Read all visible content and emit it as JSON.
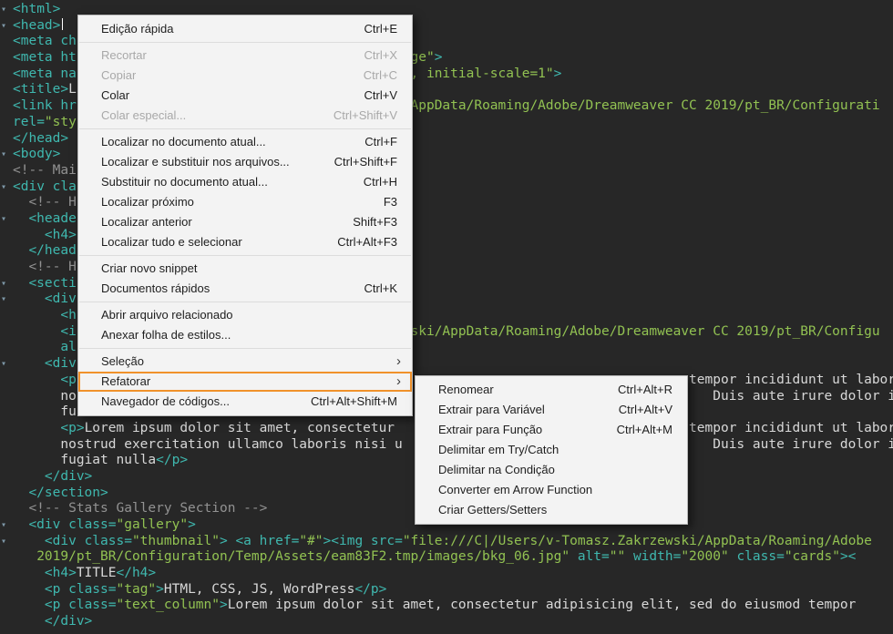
{
  "editor": {
    "background": "#272727",
    "token_colors": {
      "tag": "#3FB8AF",
      "str": "#92C252",
      "text": "#D8D8D8",
      "comment": "#929292"
    },
    "fold_icon": "▾",
    "lines": [
      {
        "fold": true,
        "runs": [
          {
            "col": 0,
            "parts": [
              {
                "t": "<html>",
                "c": "tag"
              }
            ]
          }
        ]
      },
      {
        "fold": true,
        "runs": [
          {
            "col": 0,
            "parts": [
              {
                "t": "<head>",
                "c": "tag"
              },
              {
                "t": "",
                "c": "caret"
              }
            ]
          }
        ]
      },
      {
        "runs": [
          {
            "col": 0,
            "parts": [
              {
                "t": "<meta ch",
                "c": "tag"
              }
            ]
          }
        ]
      },
      {
        "runs": [
          {
            "col": 0,
            "parts": [
              {
                "t": "<meta ht",
                "c": "tag"
              }
            ]
          },
          {
            "col": 50,
            "parts": [
              {
                "t": "ge\"",
                "c": "str"
              },
              {
                "t": ">",
                "c": "tag"
              }
            ]
          }
        ]
      },
      {
        "runs": [
          {
            "col": 0,
            "parts": [
              {
                "t": "<meta na",
                "c": "tag"
              }
            ]
          },
          {
            "col": 50,
            "parts": [
              {
                "t": ", initial-scale=1\"",
                "c": "str"
              },
              {
                "t": ">",
                "c": "tag"
              }
            ]
          }
        ]
      },
      {
        "runs": [
          {
            "col": 0,
            "parts": [
              {
                "t": "<title>",
                "c": "tag"
              },
              {
                "t": "L",
                "c": "text"
              }
            ]
          }
        ]
      },
      {
        "runs": [
          {
            "col": 0,
            "parts": [
              {
                "t": "<link hr",
                "c": "tag"
              }
            ]
          },
          {
            "col": 50,
            "parts": [
              {
                "t": "AppData/Roaming/Adobe/Dreamweaver CC 2019/pt_BR/Configurati",
                "c": "str"
              }
            ]
          }
        ]
      },
      {
        "runs": [
          {
            "col": 0,
            "parts": [
              {
                "t": "rel=",
                "c": "tag"
              },
              {
                "t": "\"sty",
                "c": "str"
              }
            ]
          }
        ]
      },
      {
        "runs": [
          {
            "col": 0,
            "parts": [
              {
                "t": "</head>",
                "c": "tag"
              }
            ]
          }
        ]
      },
      {
        "fold": true,
        "runs": [
          {
            "col": 0,
            "parts": [
              {
                "t": "<body>",
                "c": "tag"
              }
            ]
          }
        ]
      },
      {
        "runs": [
          {
            "col": 0,
            "parts": [
              {
                "t": "<!-- Mai",
                "c": "comment"
              }
            ]
          }
        ]
      },
      {
        "fold": true,
        "runs": [
          {
            "col": 0,
            "parts": [
              {
                "t": "<div cla",
                "c": "tag"
              }
            ]
          }
        ]
      },
      {
        "runs": [
          {
            "col": 2,
            "parts": [
              {
                "t": "<!-- H",
                "c": "comment"
              }
            ]
          }
        ]
      },
      {
        "fold": true,
        "runs": [
          {
            "col": 2,
            "parts": [
              {
                "t": "<heade",
                "c": "tag"
              }
            ]
          }
        ]
      },
      {
        "runs": [
          {
            "col": 4,
            "parts": [
              {
                "t": "<h4>",
                "c": "tag"
              }
            ]
          }
        ]
      },
      {
        "runs": [
          {
            "col": 2,
            "parts": [
              {
                "t": "</head",
                "c": "tag"
              }
            ]
          }
        ]
      },
      {
        "runs": [
          {
            "col": 2,
            "parts": [
              {
                "t": "<!-- H",
                "c": "comment"
              }
            ]
          }
        ]
      },
      {
        "fold": true,
        "runs": [
          {
            "col": 2,
            "parts": [
              {
                "t": "<secti",
                "c": "tag"
              }
            ]
          }
        ]
      },
      {
        "fold": true,
        "runs": [
          {
            "col": 4,
            "parts": [
              {
                "t": "<div",
                "c": "tag"
              }
            ]
          }
        ]
      },
      {
        "runs": [
          {
            "col": 6,
            "parts": [
              {
                "t": "<h",
                "c": "tag"
              }
            ]
          }
        ]
      },
      {
        "runs": [
          {
            "col": 6,
            "parts": [
              {
                "t": "<i",
                "c": "tag"
              }
            ]
          },
          {
            "col": 50,
            "parts": [
              {
                "t": "ski/AppData/Roaming/Adobe/Dreamweaver CC 2019/pt_BR/Configu",
                "c": "str"
              }
            ]
          }
        ]
      },
      {
        "runs": [
          {
            "col": 6,
            "parts": [
              {
                "t": "al",
                "c": "tag"
              }
            ]
          }
        ]
      },
      {
        "fold": true,
        "runs": [
          {
            "col": 4,
            "parts": [
              {
                "t": "<div",
                "c": "tag"
              }
            ]
          }
        ]
      },
      {
        "runs": [
          {
            "col": 6,
            "parts": [
              {
                "t": "<p",
                "c": "tag"
              }
            ]
          },
          {
            "col": 85,
            "parts": [
              {
                "t": "tempor incididunt ut labor",
                "c": "text"
              }
            ]
          }
        ]
      },
      {
        "runs": [
          {
            "col": 6,
            "parts": [
              {
                "t": "no",
                "c": "text"
              }
            ]
          },
          {
            "col": 88,
            "parts": [
              {
                "t": "Duis aute irure dolor ir",
                "c": "text"
              }
            ]
          }
        ]
      },
      {
        "runs": [
          {
            "col": 6,
            "parts": [
              {
                "t": "fu",
                "c": "text"
              }
            ]
          }
        ]
      },
      {
        "runs": [
          {
            "col": 6,
            "parts": [
              {
                "t": "<p>",
                "c": "tag"
              },
              {
                "t": "Lorem ipsum dolor sit amet, consectetur ",
                "c": "text"
              }
            ]
          },
          {
            "col": 85,
            "parts": [
              {
                "t": "tempor incididunt ut labor",
                "c": "text"
              }
            ]
          }
        ]
      },
      {
        "runs": [
          {
            "col": 6,
            "parts": [
              {
                "t": "nostrud exercitation ullamco laboris nisi u",
                "c": "text"
              }
            ]
          },
          {
            "col": 88,
            "parts": [
              {
                "t": "Duis aute irure dolor ir",
                "c": "text"
              }
            ]
          }
        ]
      },
      {
        "runs": [
          {
            "col": 6,
            "parts": [
              {
                "t": "fugiat nulla",
                "c": "text"
              },
              {
                "t": "</p>",
                "c": "tag"
              }
            ]
          }
        ]
      },
      {
        "runs": [
          {
            "col": 4,
            "parts": [
              {
                "t": "</div>",
                "c": "tag"
              }
            ]
          }
        ]
      },
      {
        "runs": [
          {
            "col": 2,
            "parts": [
              {
                "t": "</section>",
                "c": "tag"
              }
            ]
          }
        ]
      },
      {
        "runs": [
          {
            "col": 2,
            "parts": [
              {
                "t": "<!-- Stats Gallery Section -->",
                "c": "comment"
              }
            ]
          }
        ]
      },
      {
        "fold": true,
        "runs": [
          {
            "col": 2,
            "parts": [
              {
                "t": "<div ",
                "c": "tag"
              },
              {
                "t": "class=",
                "c": "tag"
              },
              {
                "t": "\"gallery\"",
                "c": "str"
              },
              {
                "t": ">",
                "c": "tag"
              }
            ]
          }
        ]
      },
      {
        "fold": true,
        "runs": [
          {
            "col": 4,
            "parts": [
              {
                "t": "<div ",
                "c": "tag"
              },
              {
                "t": "class=",
                "c": "tag"
              },
              {
                "t": "\"thumbnail\"",
                "c": "str"
              },
              {
                "t": "> ",
                "c": "tag"
              },
              {
                "t": "<a ",
                "c": "tag"
              },
              {
                "t": "href=",
                "c": "tag"
              },
              {
                "t": "\"#\"",
                "c": "str"
              },
              {
                "t": ">",
                "c": "tag"
              },
              {
                "t": "<img ",
                "c": "tag"
              },
              {
                "t": "src=",
                "c": "tag"
              },
              {
                "t": "\"file:///C|/Users/v-Tomasz.Zakrzewski/AppData/Roaming/Adobe",
                "c": "str"
              }
            ]
          }
        ]
      },
      {
        "runs": [
          {
            "col": 3,
            "parts": [
              {
                "t": "2019/pt_BR/Configuration/Temp/Assets/eam83F2.tmp/images/bkg_06.jpg\"",
                "c": "str"
              },
              {
                "t": " alt=",
                "c": "tag"
              },
              {
                "t": "\"\"",
                "c": "str"
              },
              {
                "t": " width=",
                "c": "tag"
              },
              {
                "t": "\"2000\"",
                "c": "str"
              },
              {
                "t": " class=",
                "c": "tag"
              },
              {
                "t": "\"cards\"",
                "c": "str"
              },
              {
                "t": "><",
                "c": "tag"
              }
            ]
          }
        ]
      },
      {
        "runs": [
          {
            "col": 4,
            "parts": [
              {
                "t": "<h4>",
                "c": "tag"
              },
              {
                "t": "TITLE",
                "c": "text"
              },
              {
                "t": "</h4>",
                "c": "tag"
              }
            ]
          }
        ]
      },
      {
        "runs": [
          {
            "col": 4,
            "parts": [
              {
                "t": "<p ",
                "c": "tag"
              },
              {
                "t": "class=",
                "c": "tag"
              },
              {
                "t": "\"tag\"",
                "c": "str"
              },
              {
                "t": ">",
                "c": "tag"
              },
              {
                "t": "HTML, CSS, JS, WordPress",
                "c": "text"
              },
              {
                "t": "</p>",
                "c": "tag"
              }
            ]
          }
        ]
      },
      {
        "runs": [
          {
            "col": 4,
            "parts": [
              {
                "t": "<p ",
                "c": "tag"
              },
              {
                "t": "class=",
                "c": "tag"
              },
              {
                "t": "\"text_column\"",
                "c": "str"
              },
              {
                "t": ">",
                "c": "tag"
              },
              {
                "t": "Lorem ipsum dolor sit amet, consectetur adipisicing elit, sed do eiusmod tempor",
                "c": "text"
              }
            ]
          }
        ]
      },
      {
        "runs": [
          {
            "col": 4,
            "parts": [
              {
                "t": "</div>",
                "c": "tag"
              }
            ]
          }
        ]
      }
    ]
  },
  "context_menu": {
    "background": "#F3F3F3",
    "highlight_color": "#F0922B",
    "submenu_arrow": "›",
    "items": [
      {
        "name": "menu-item-edicao-rapida",
        "label": "Edição rápida",
        "shortcut": "Ctrl+E"
      },
      {
        "type": "separator"
      },
      {
        "name": "menu-item-recortar",
        "label": "Recortar",
        "shortcut": "Ctrl+X",
        "disabled": true
      },
      {
        "name": "menu-item-copiar",
        "label": "Copiar",
        "shortcut": "Ctrl+C",
        "disabled": true
      },
      {
        "name": "menu-item-colar",
        "label": "Colar",
        "shortcut": "Ctrl+V"
      },
      {
        "name": "menu-item-colar-especial",
        "label": "Colar especial...",
        "shortcut": "Ctrl+Shift+V",
        "disabled": true
      },
      {
        "type": "separator"
      },
      {
        "name": "menu-item-localizar-no-documento-atual",
        "label": "Localizar no documento atual...",
        "shortcut": "Ctrl+F"
      },
      {
        "name": "menu-item-localizar-e-substituir-nos-arquivos",
        "label": "Localizar e substituir nos arquivos...",
        "shortcut": "Ctrl+Shift+F"
      },
      {
        "name": "menu-item-substituir-no-documento-atual",
        "label": "Substituir no documento atual...",
        "shortcut": "Ctrl+H"
      },
      {
        "name": "menu-item-localizar-proximo",
        "label": "Localizar próximo",
        "shortcut": "F3"
      },
      {
        "name": "menu-item-localizar-anterior",
        "label": "Localizar anterior",
        "shortcut": "Shift+F3"
      },
      {
        "name": "menu-item-localizar-tudo-e-selecionar",
        "label": "Localizar tudo e selecionar",
        "shortcut": "Ctrl+Alt+F3"
      },
      {
        "type": "separator"
      },
      {
        "name": "menu-item-criar-novo-snippet",
        "label": "Criar novo snippet"
      },
      {
        "name": "menu-item-documentos-rapidos",
        "label": "Documentos rápidos",
        "shortcut": "Ctrl+K"
      },
      {
        "type": "separator"
      },
      {
        "name": "menu-item-abrir-arquivo-relacionado",
        "label": "Abrir arquivo relacionado"
      },
      {
        "name": "menu-item-anexar-folha-de-estilos",
        "label": "Anexar folha de estilos..."
      },
      {
        "type": "separator"
      },
      {
        "name": "menu-item-selecao",
        "label": "Seleção",
        "submenu": true
      },
      {
        "name": "menu-item-refatorar",
        "label": "Refatorar",
        "submenu": true,
        "highlighted": true
      },
      {
        "name": "menu-item-navegador-de-codigos",
        "label": "Navegador de códigos...",
        "shortcut": "Ctrl+Alt+Shift+M"
      }
    ]
  },
  "submenu": {
    "items": [
      {
        "name": "submenu-item-renomear",
        "label": "Renomear",
        "shortcut": "Ctrl+Alt+R"
      },
      {
        "name": "submenu-item-extrair-para-variavel",
        "label": "Extrair para Variável",
        "shortcut": "Ctrl+Alt+V"
      },
      {
        "name": "submenu-item-extrair-para-funcao",
        "label": "Extrair para Função",
        "shortcut": "Ctrl+Alt+M"
      },
      {
        "name": "submenu-item-delimitar-em-try-catch",
        "label": "Delimitar em Try/Catch"
      },
      {
        "name": "submenu-item-delimitar-na-condicao",
        "label": "Delimitar na Condição"
      },
      {
        "name": "submenu-item-converter-em-arrow-function",
        "label": "Converter em Arrow Function"
      },
      {
        "name": "submenu-item-criar-getters-setters",
        "label": "Criar Getters/Setters"
      }
    ]
  }
}
